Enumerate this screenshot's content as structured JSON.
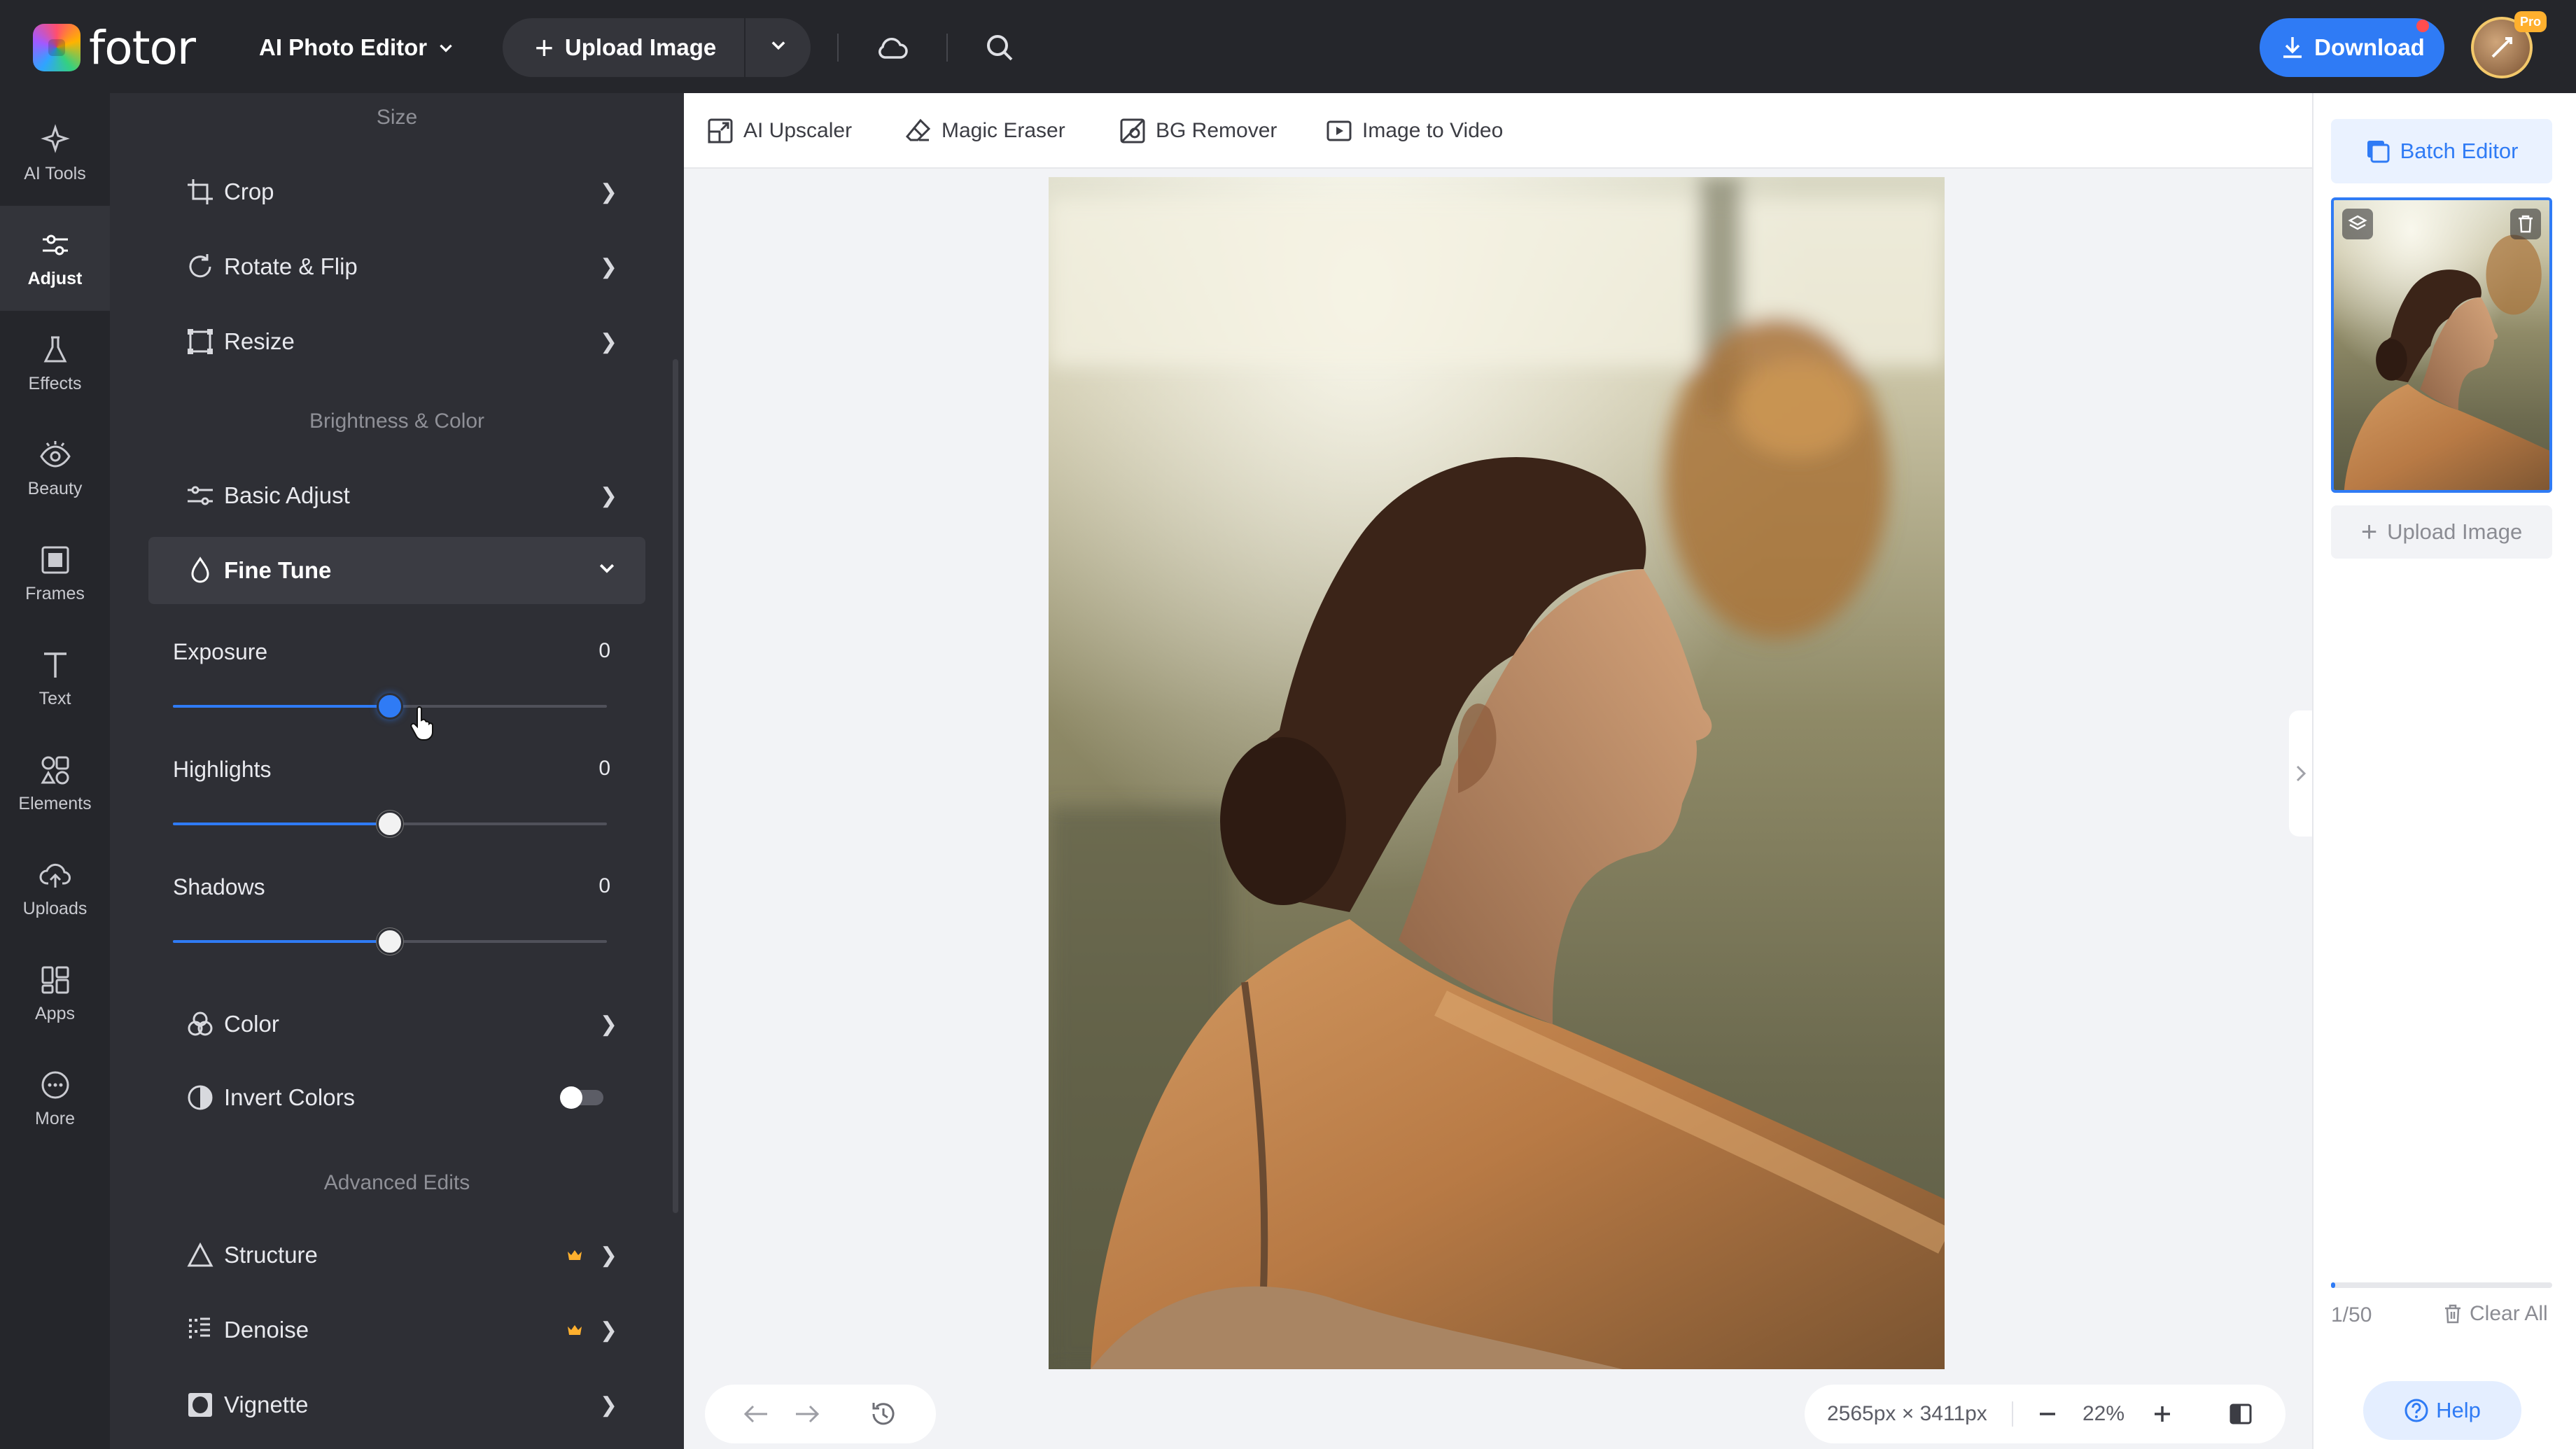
{
  "header": {
    "logo_text": "fotor",
    "editor_menu_label": "AI Photo Editor",
    "upload_label": "Upload Image",
    "download_label": "Download",
    "pro_badge": "Pro"
  },
  "rail": {
    "items": [
      {
        "label": "AI Tools",
        "icon": "sparkle-icon"
      },
      {
        "label": "Adjust",
        "icon": "sliders-icon",
        "active": true
      },
      {
        "label": "Effects",
        "icon": "flask-icon"
      },
      {
        "label": "Beauty",
        "icon": "eye-icon"
      },
      {
        "label": "Frames",
        "icon": "frame-icon"
      },
      {
        "label": "Text",
        "icon": "text-icon"
      },
      {
        "label": "Elements",
        "icon": "shapes-icon"
      },
      {
        "label": "Uploads",
        "icon": "cloud-upload-icon"
      },
      {
        "label": "Apps",
        "icon": "apps-icon"
      },
      {
        "label": "More",
        "icon": "more-icon"
      }
    ]
  },
  "panel": {
    "size_title": "Size",
    "crop": "Crop",
    "rotate_flip": "Rotate & Flip",
    "resize": "Resize",
    "brightness_title": "Brightness & Color",
    "basic_adjust": "Basic Adjust",
    "fine_tune": "Fine Tune",
    "sliders": [
      {
        "label": "Exposure",
        "value": "0",
        "level": 0.5,
        "active": true
      },
      {
        "label": "Highlights",
        "value": "0",
        "level": 0.5
      },
      {
        "label": "Shadows",
        "value": "0",
        "level": 0.5
      }
    ],
    "color": "Color",
    "invert_colors": "Invert Colors",
    "invert_enabled": false,
    "advanced_title": "Advanced Edits",
    "structure": "Structure",
    "denoise": "Denoise",
    "vignette": "Vignette"
  },
  "quick_tools": {
    "ai_upscaler": "AI Upscaler",
    "magic_eraser": "Magic Eraser",
    "bg_remover": "BG Remover",
    "image_to_video": "Image to Video"
  },
  "status": {
    "dimensions": "2565px × 3411px",
    "zoom": "22%"
  },
  "right_panel": {
    "batch_editor": "Batch Editor",
    "upload_label": "Upload Image",
    "count": "1/50",
    "upload_progress": 0.02,
    "clear_all": "Clear All",
    "help": "Help"
  },
  "colors": {
    "accent": "#2f7bf5",
    "sidebar_bg": "#25262b",
    "panel_bg": "#2e2f35",
    "canvas_bg": "#f2f3f6",
    "premium_crown": "#ffb02e"
  }
}
